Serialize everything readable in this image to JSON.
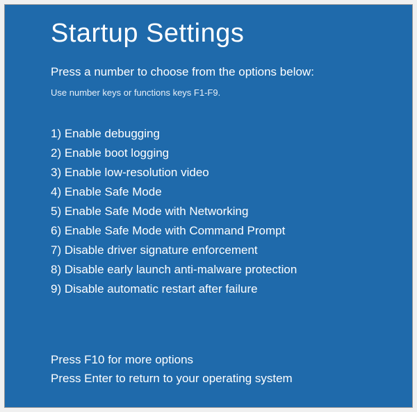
{
  "title": "Startup Settings",
  "subtitle": "Press a number to choose from the options below:",
  "hint": "Use number keys or functions keys F1-F9.",
  "options": [
    "1) Enable debugging",
    "2) Enable boot logging",
    "3) Enable low-resolution video",
    "4) Enable Safe Mode",
    "5) Enable Safe Mode with Networking",
    "6) Enable Safe Mode with Command Prompt",
    "7) Disable driver signature enforcement",
    "8) Disable early launch anti-malware protection",
    "9) Disable automatic restart after failure"
  ],
  "footer": {
    "more": "Press F10 for more options",
    "return": "Press Enter to return to your operating system"
  }
}
